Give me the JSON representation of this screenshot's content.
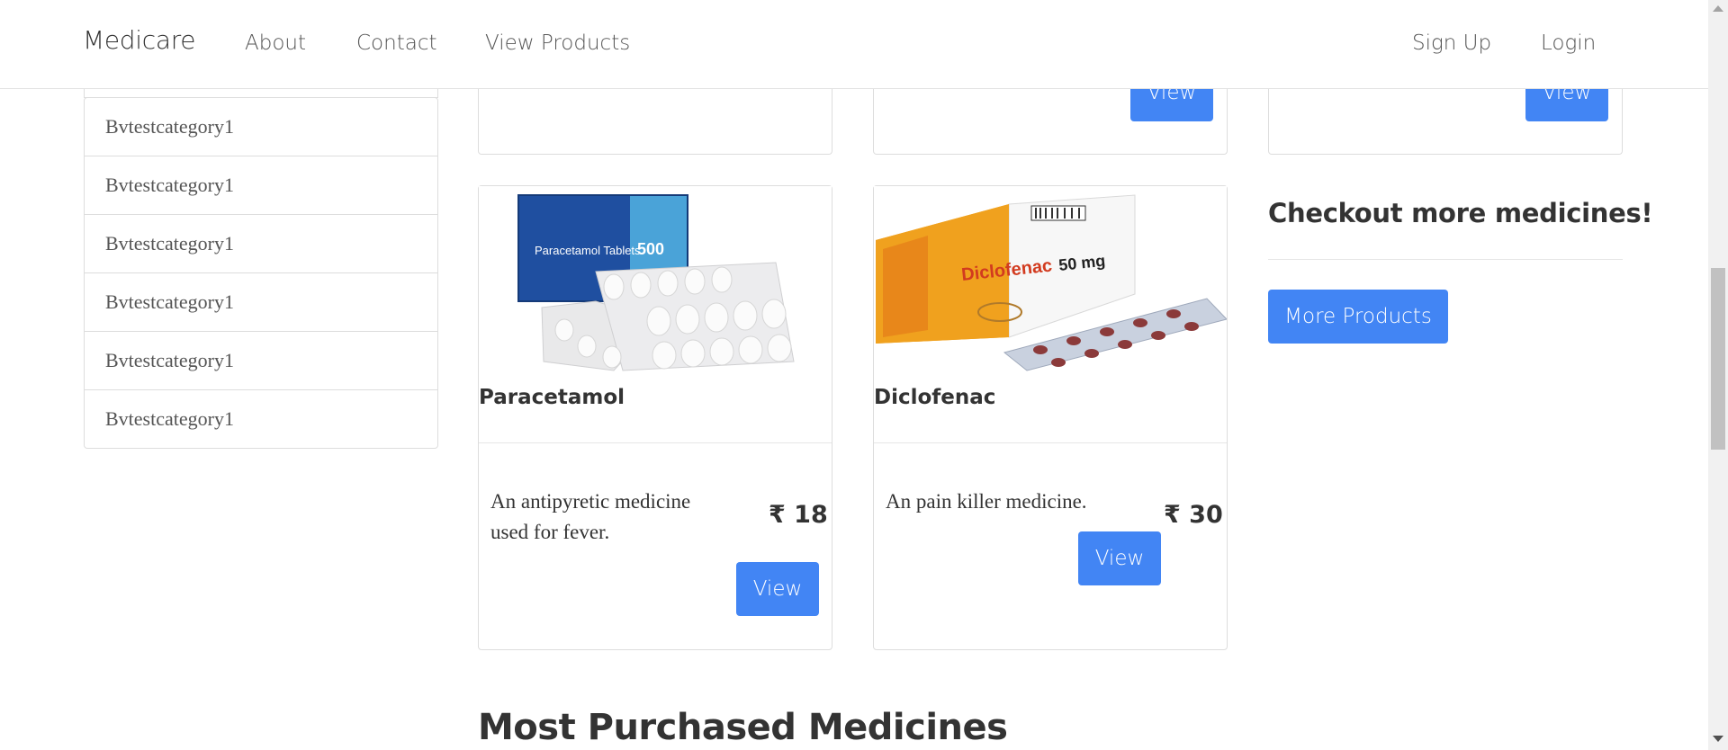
{
  "nav": {
    "brand": "Medicare",
    "links": [
      "About",
      "Contact",
      "View Products"
    ],
    "right_links": [
      "Sign Up",
      "Login"
    ]
  },
  "sidebar": {
    "items": [
      "Bvtestcategory1",
      "Bvtestcategory1",
      "Bvtestcategory1",
      "Bvtestcategory1",
      "Bvtestcategory1",
      "Bvtestcategory1"
    ]
  },
  "top_cards": {
    "view_label": "View"
  },
  "products": [
    {
      "name": "Paracetamol",
      "description": "An antipyretic medicine used for fever.",
      "price": "₹ 18",
      "view_label": "View",
      "image_icon": "paracetamol-tablets-image",
      "box_text": "Paracetamol Tablets",
      "box_strength": "500"
    },
    {
      "name": "Diclofenac",
      "description": "An pain killer medicine.",
      "price": "₹ 30",
      "view_label": "View",
      "image_icon": "diclofenac-tablets-image",
      "box_text": "Diclofenac",
      "box_strength": "50 mg"
    }
  ],
  "checkout": {
    "title": "Checkout more medicines!",
    "button_label": "More Products"
  },
  "section_title": "Most Purchased Medicines",
  "colors": {
    "accent": "#4285f4",
    "text": "#333333",
    "border": "#dddddd"
  }
}
